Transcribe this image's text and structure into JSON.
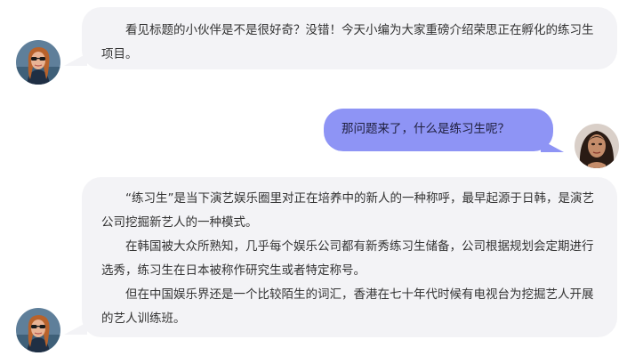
{
  "messages": [
    {
      "side": "left",
      "avatar": "woman-sunglasses-avatar",
      "paragraphs": [
        "看见标题的小伙伴是不是很好奇？没错！今天小编为大家重磅介绍荣思正在孵化的练习生项目。"
      ]
    },
    {
      "side": "right",
      "avatar": "woman-portrait-avatar",
      "paragraphs": [
        "那问题来了，什么是练习生呢？"
      ]
    },
    {
      "side": "left",
      "avatar": "woman-sunglasses-avatar",
      "paragraphs": [
        "“练习生”是当下演艺娱乐圈里对正在培养中的新人的一种称呼，最早起源于日韩，是演艺公司挖掘新艺人的一种模式。",
        "在韩国被大众所熟知，几乎每个娱乐公司都有新秀练习生储备，公司根据规划会定期进行选秀，练习生在日本被称作研究生或者特定称号。",
        "但在中国娱乐界还是一个比较陌生的词汇，香港在七十年代时候有电视台为挖掘艺人开展的艺人训练班。"
      ]
    }
  ],
  "colors": {
    "left_bubble": "#f3f3f6",
    "right_bubble": "#8e94f5",
    "text": "#333333"
  }
}
